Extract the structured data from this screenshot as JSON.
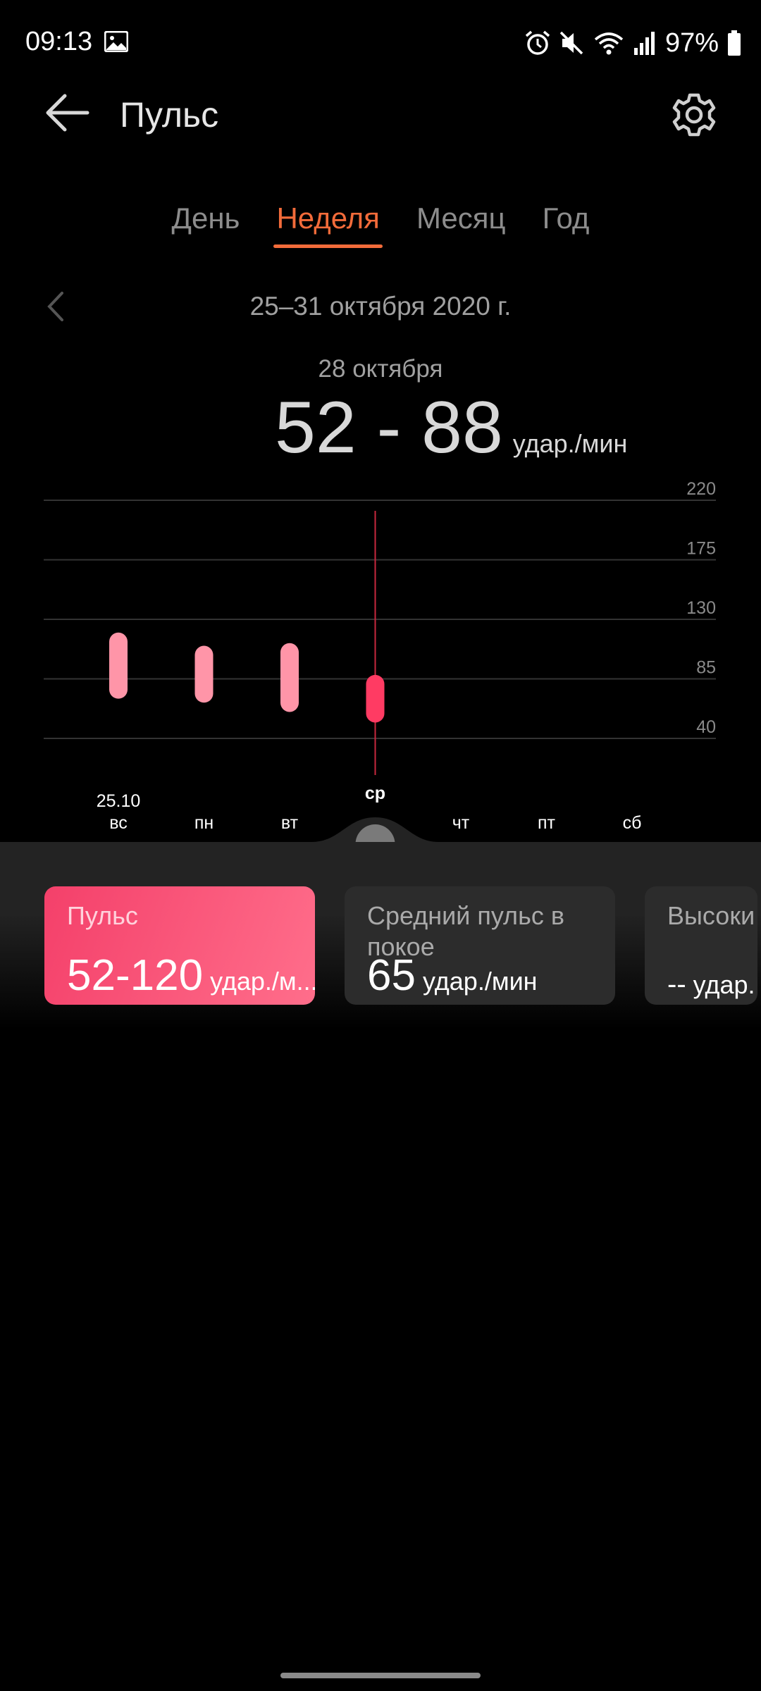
{
  "status_bar": {
    "time": "09:13",
    "battery": "97%"
  },
  "header": {
    "title": "Пульс"
  },
  "tabs": [
    {
      "label": "День",
      "active": false
    },
    {
      "label": "Неделя",
      "active": true
    },
    {
      "label": "Месяц",
      "active": false
    },
    {
      "label": "Год",
      "active": false
    }
  ],
  "range": {
    "label": "25–31 октября 2020 г."
  },
  "selection": {
    "date": "28 октября",
    "value": "52 - 88",
    "unit": "удар./мин"
  },
  "colors": {
    "accent": "#f26b3a",
    "bar": "#ff95a8",
    "bar_selected": "#ff3b63"
  },
  "chart_data": {
    "type": "range-bar",
    "y_ticks": [
      40,
      85,
      130,
      175,
      220
    ],
    "ylim": [
      40,
      220
    ],
    "categories": [
      "вс",
      "пн",
      "вт",
      "ср",
      "чт",
      "пт",
      "сб"
    ],
    "first_date_label": "25.10",
    "series": [
      {
        "values": [
          {
            "min": 70,
            "max": 120
          },
          {
            "min": 67,
            "max": 110
          },
          {
            "min": 60,
            "max": 112
          },
          {
            "min": 52,
            "max": 88
          },
          null,
          null,
          null
        ]
      }
    ],
    "selected_index": 3
  },
  "cards": [
    {
      "title": "Пульс",
      "value": "52-120",
      "unit": "удар./м..."
    },
    {
      "title": "Средний пульс в покое",
      "value": "65",
      "unit": "удар./мин"
    },
    {
      "title": "Высоки",
      "value": "--",
      "unit": "удар."
    }
  ]
}
